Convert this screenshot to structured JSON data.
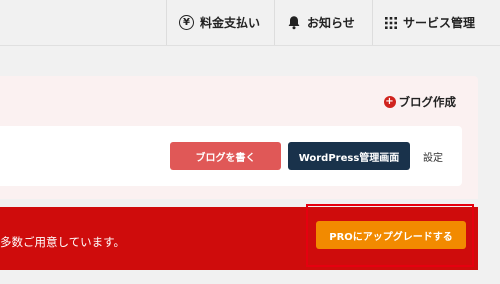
{
  "header": {
    "payment_label": "料金支払い",
    "notice_label": "お知らせ",
    "service_label": "サービス管理"
  },
  "panel": {
    "create_blog_label": "ブログ作成",
    "write_blog_label": "ブログを書く",
    "wp_admin_label": "WordPress管理画面",
    "settings_label": "設定"
  },
  "banner": {
    "text": "多数ご用意しています。",
    "upgrade_label": "PROにアップグレードする"
  },
  "icons": {
    "payment": "yen-icon",
    "notice": "bell-icon",
    "service": "grid-icon",
    "create": "plus-circle-icon"
  },
  "colors": {
    "accent_red": "#cf0c0c",
    "button_red": "#e05857",
    "button_navy": "#19324b",
    "button_orange": "#f28a00"
  }
}
